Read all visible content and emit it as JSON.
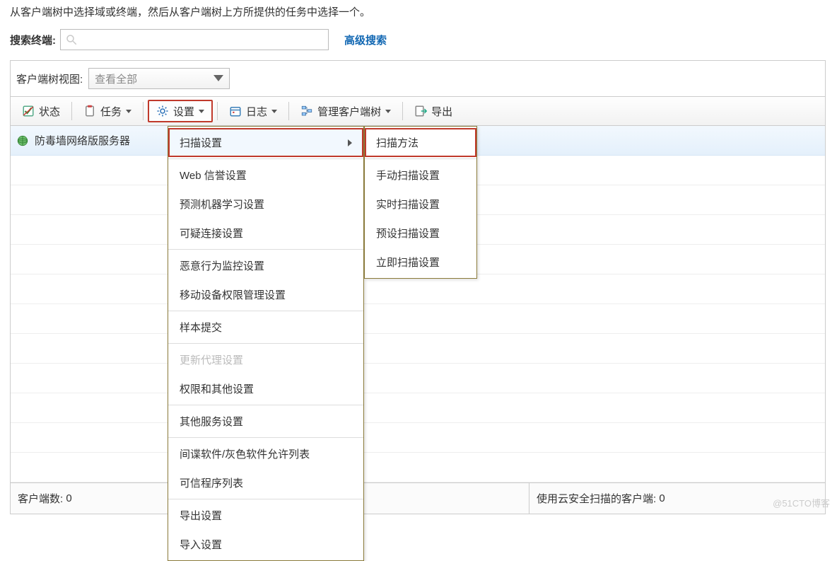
{
  "intro_text": "从客户端树中选择域或终端，然后从客户端树上方所提供的任务中选择一个。",
  "search": {
    "label": "搜索终端:",
    "placeholder": "",
    "advanced": "高级搜索"
  },
  "view": {
    "label": "客户端树视图:",
    "selected": "查看全部"
  },
  "toolbar": {
    "status": "状态",
    "task": "任务",
    "settings": "设置",
    "log": "日志",
    "manage_tree": "管理客户端树",
    "export": "导出"
  },
  "tree": {
    "root": "防毒墙网络版服务器"
  },
  "settings_menu": [
    {
      "label": "扫描设置",
      "has_sub": true,
      "highlight": true
    },
    {
      "sep": true
    },
    {
      "label": "Web 信誉设置"
    },
    {
      "label": "预测机器学习设置"
    },
    {
      "label": "可疑连接设置"
    },
    {
      "sep": true
    },
    {
      "label": "恶意行为监控设置"
    },
    {
      "label": "移动设备权限管理设置"
    },
    {
      "sep": true
    },
    {
      "label": "样本提交"
    },
    {
      "sep": true
    },
    {
      "label": "更新代理设置",
      "disabled": true
    },
    {
      "label": "权限和其他设置"
    },
    {
      "sep": true
    },
    {
      "label": "其他服务设置"
    },
    {
      "sep": true
    },
    {
      "label": "间谍软件/灰色软件允许列表"
    },
    {
      "label": "可信程序列表"
    },
    {
      "sep": true
    },
    {
      "label": "导出设置"
    },
    {
      "label": "导入设置"
    }
  ],
  "scan_submenu": [
    "扫描方法",
    "手动扫描设置",
    "实时扫描设置",
    "预设扫描设置",
    "立即扫描设置"
  ],
  "status_bar": {
    "client_count_label": "客户端数:",
    "client_count_value": "0",
    "cloud_scan_label": "使用云安全扫描的客户端:",
    "cloud_scan_value": "0"
  },
  "watermark": "@51CTO博客"
}
